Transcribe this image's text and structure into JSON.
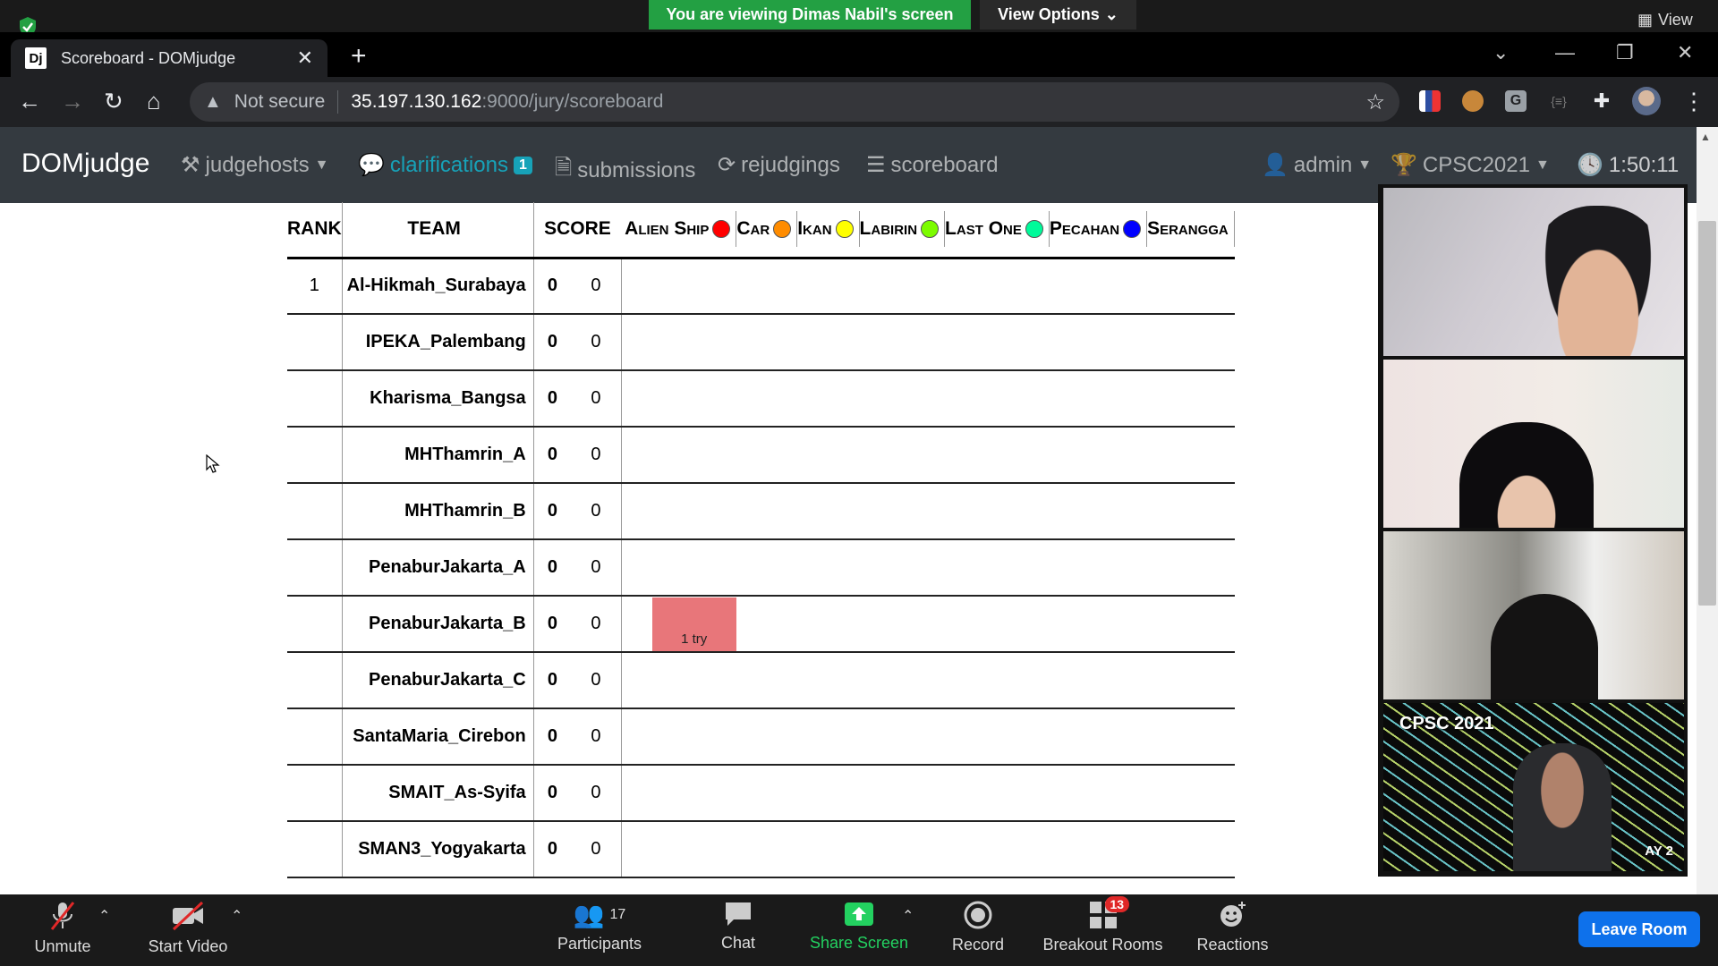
{
  "zoom": {
    "viewing_banner": "You are viewing Dimas Nabil's screen",
    "view_options_label": "View Options",
    "view_label": "View",
    "bottom_bar": {
      "unmute_label": "Unmute",
      "start_video_label": "Start Video",
      "participants_label": "Participants",
      "participants_count": "17",
      "chat_label": "Chat",
      "share_screen_label": "Share Screen",
      "record_label": "Record",
      "breakout_rooms_label": "Breakout Rooms",
      "breakout_badge": "13",
      "reactions_label": "Reactions",
      "leave_room_label": "Leave Room"
    },
    "video_tiles": [
      {
        "overlay_text": ""
      },
      {
        "overlay_text": ""
      },
      {
        "overlay_text": ""
      },
      {
        "overlay_text": "CPSC 2021",
        "overlay_text_2": "AY 2"
      }
    ]
  },
  "browser": {
    "tab_title": "Scoreboard - DOMjudge",
    "tab_favicon": "Dj",
    "security_label": "Not secure",
    "url_host": "35.197.130.162",
    "url_path": ":9000/jury/scoreboard"
  },
  "domjudge": {
    "brand": "DOMjudge",
    "nav": {
      "judgehosts": "judgehosts",
      "clarifications": "clarifications",
      "clarifications_badge": "1",
      "submissions": "submissions",
      "rejudgings": "rejudgings",
      "scoreboard": "scoreboard",
      "user": "admin",
      "contest": "CPSC2021",
      "time": "1:50:11"
    },
    "scoreboard": {
      "headers": {
        "rank": "RANK",
        "team": "TEAM",
        "score": "SCORE"
      },
      "problems": [
        {
          "name": "Alien Ship",
          "color": "#ff0000"
        },
        {
          "name": "Car",
          "color": "#ff8c00"
        },
        {
          "name": "Ikan",
          "color": "#ffff00"
        },
        {
          "name": "Labirin",
          "color": "#7cfc00"
        },
        {
          "name": "Last One",
          "color": "#00fa9a"
        },
        {
          "name": "Pecahan",
          "color": "#0000ff"
        },
        {
          "name": "Serangga",
          "color": ""
        }
      ],
      "rows": [
        {
          "rank": "1",
          "team": "Al-Hikmah_Surabaya",
          "solved": "0",
          "time": "0",
          "attempt": ""
        },
        {
          "rank": "",
          "team": "IPEKA_Palembang",
          "solved": "0",
          "time": "0",
          "attempt": ""
        },
        {
          "rank": "",
          "team": "Kharisma_Bangsa",
          "solved": "0",
          "time": "0",
          "attempt": ""
        },
        {
          "rank": "",
          "team": "MHThamrin_A",
          "solved": "0",
          "time": "0",
          "attempt": ""
        },
        {
          "rank": "",
          "team": "MHThamrin_B",
          "solved": "0",
          "time": "0",
          "attempt": ""
        },
        {
          "rank": "",
          "team": "PenaburJakarta_A",
          "solved": "0",
          "time": "0",
          "attempt": ""
        },
        {
          "rank": "",
          "team": "PenaburJakarta_B",
          "solved": "0",
          "time": "0",
          "attempt": "1 try"
        },
        {
          "rank": "",
          "team": "PenaburJakarta_C",
          "solved": "0",
          "time": "0",
          "attempt": ""
        },
        {
          "rank": "",
          "team": "SantaMaria_Cirebon",
          "solved": "0",
          "time": "0",
          "attempt": ""
        },
        {
          "rank": "",
          "team": "SMAIT_As-Syifa",
          "solved": "0",
          "time": "0",
          "attempt": ""
        },
        {
          "rank": "",
          "team": "SMAN3_Yogyakarta",
          "solved": "0",
          "time": "0",
          "attempt": ""
        }
      ]
    }
  }
}
